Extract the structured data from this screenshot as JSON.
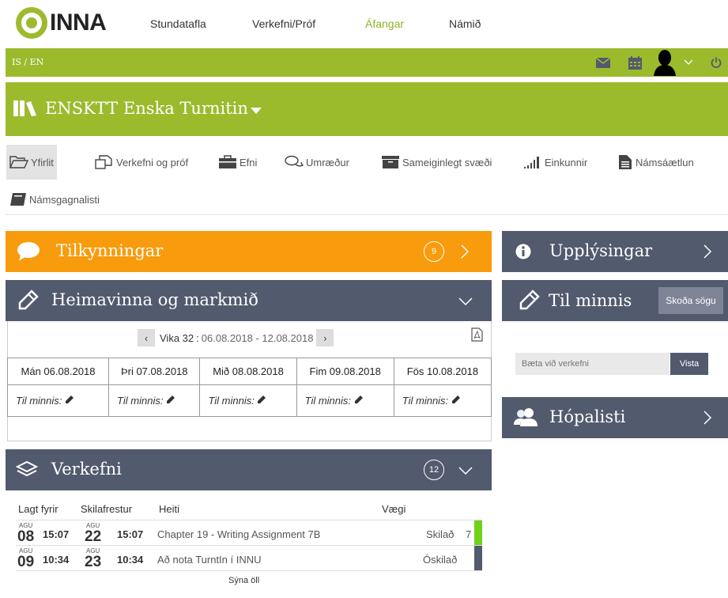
{
  "app": {
    "logo_text": "INNA"
  },
  "nav": {
    "items": [
      "Stundatafla",
      "Verkefni/Próf",
      "Áfangar",
      "Námið"
    ],
    "active": "Áfangar"
  },
  "topbar": {
    "lang": "IS / EN",
    "icons": [
      "mail-icon",
      "calendar-icon",
      "user-avatar",
      "chevron-down-icon",
      "power-icon"
    ]
  },
  "course": {
    "title": "ENSKTT Enska Turnitin"
  },
  "tabs": [
    {
      "label": "Yfirlit",
      "icon": "folder-open-icon"
    },
    {
      "label": "Verkefni og próf",
      "icon": "copy-icon"
    },
    {
      "label": "Efni",
      "icon": "briefcase-icon"
    },
    {
      "label": "Umræður",
      "icon": "comments-icon"
    },
    {
      "label": "Sameiginlegt svæði",
      "icon": "archive-icon"
    },
    {
      "label": "Einkunnir",
      "icon": "signal-icon"
    },
    {
      "label": "Námsáætlun",
      "icon": "file-text-icon"
    },
    {
      "label": "Námsgagnalisti",
      "icon": "book-icon"
    }
  ],
  "announcements": {
    "title": "Tilkynningar",
    "count": "9"
  },
  "homework": {
    "title": "Heimavinna og markmið",
    "week_label": "Vika 32",
    "week_dates": "06.08.2018 - 12.08.2018",
    "days": [
      "Mán 06.08.2018",
      "Þri 07.08.2018",
      "Mið 08.08.2018",
      "Fim 09.08.2018",
      "Fös 10.08.2018"
    ],
    "memo_label": "Til minnis:"
  },
  "assignments": {
    "title": "Verkefni",
    "count": "12",
    "headers": {
      "posted": "Lagt fyrir",
      "due": "Skilafrestur",
      "name": "Heiti",
      "weight": "Vægi"
    },
    "rows": [
      {
        "posted_month": "AGU",
        "posted_day": "08",
        "posted_time": "15:07",
        "due_month": "AGU",
        "due_day": "22",
        "due_time": "15:07",
        "name": "Chapter 19 - Writing Assignment 7B",
        "status": "Skilað",
        "weight": "7",
        "status_color": "#6fd11a"
      },
      {
        "posted_month": "AGU",
        "posted_day": "09",
        "posted_time": "10:34",
        "due_month": "AGU",
        "due_day": "23",
        "due_time": "10:34",
        "name": "Að nota TurntIn í INNU",
        "status": "Óskilað",
        "weight": "",
        "status_color": "#525a6e"
      }
    ],
    "show_all": "Sýna öll"
  },
  "info": {
    "title": "Upplýsingar"
  },
  "reminder": {
    "title": "Til minnis",
    "history_button": "Skoða sögu",
    "placeholder": "Bæta við verkefni",
    "save": "Vista"
  },
  "group": {
    "title": "Hópalisti"
  },
  "colors": {
    "green": "#9bbb2d",
    "navy": "#525a6e",
    "orange": "#f89b0c"
  }
}
